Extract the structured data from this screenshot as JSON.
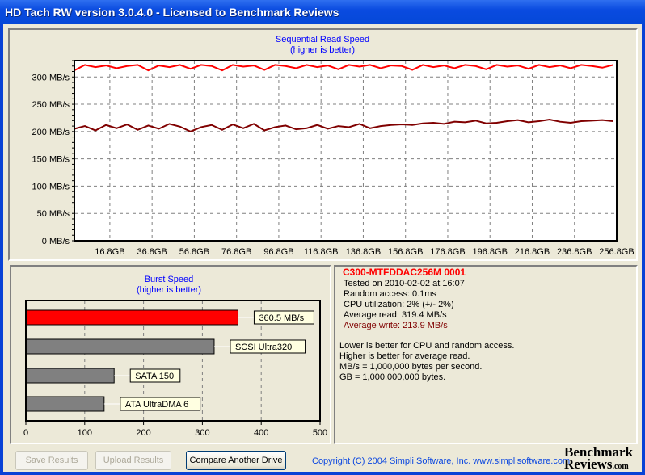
{
  "window": {
    "title": "HD Tach RW version 3.0.4.0 - Licensed to Benchmark Reviews"
  },
  "chart_data": [
    {
      "type": "line",
      "title": "Sequential Read Speed",
      "subtitle": "(higher is better)",
      "y_ticks": [
        "0 MB/s",
        "50 MB/s",
        "100 MB/s",
        "150 MB/s",
        "200 MB/s",
        "250 MB/s",
        "300 MB/s"
      ],
      "x_ticks": [
        "16.8GB",
        "36.8GB",
        "56.8GB",
        "76.8GB",
        "96.8GB",
        "116.8GB",
        "136.8GB",
        "156.8GB",
        "176.8GB",
        "196.8GB",
        "216.8GB",
        "236.8GB",
        "256.8GB"
      ],
      "xlim": [
        0,
        256.8
      ],
      "ylim": [
        0,
        330
      ],
      "grid": true,
      "x": [
        0,
        5,
        10,
        15,
        20,
        25,
        30,
        35,
        40,
        45,
        50,
        55,
        60,
        65,
        70,
        75,
        80,
        85,
        90,
        95,
        100,
        105,
        110,
        115,
        120,
        125,
        130,
        135,
        140,
        145,
        150,
        155,
        160,
        165,
        170,
        175,
        180,
        185,
        190,
        195,
        200,
        205,
        210,
        215,
        220,
        225,
        230,
        235,
        240,
        245,
        250,
        255
      ],
      "series": [
        {
          "color": "#ff0000",
          "values": [
            312,
            322,
            318,
            321,
            316,
            320,
            322,
            312,
            321,
            318,
            322,
            315,
            322,
            320,
            312,
            322,
            319,
            321,
            313,
            322,
            320,
            316,
            322,
            318,
            321,
            314,
            322,
            319,
            322,
            316,
            321,
            320,
            313,
            322,
            318,
            321,
            316,
            322,
            320,
            314,
            322,
            319,
            321,
            315,
            322,
            318,
            321,
            316,
            322,
            320,
            317,
            322
          ]
        },
        {
          "color": "#800000",
          "values": [
            205,
            210,
            202,
            212,
            206,
            213,
            203,
            211,
            205,
            214,
            209,
            200,
            208,
            212,
            203,
            213,
            206,
            214,
            202,
            208,
            211,
            204,
            206,
            212,
            205,
            210,
            208,
            214,
            206,
            210,
            212,
            213,
            212,
            215,
            216,
            214,
            218,
            217,
            220,
            215,
            216,
            219,
            221,
            217,
            219,
            222,
            218,
            216,
            219,
            220,
            221,
            219
          ]
        }
      ]
    },
    {
      "type": "bar",
      "title": "Burst Speed",
      "subtitle": "(higher is better)",
      "orientation": "horizontal",
      "xlim": [
        0,
        500
      ],
      "x_ticks": [
        "0",
        "100",
        "200",
        "300",
        "400",
        "500"
      ],
      "grid": true,
      "categories": [
        "360.5 MB/s",
        "SCSI Ultra320",
        "SATA 150",
        "ATA UltraDMA 6"
      ],
      "values": [
        360.5,
        320,
        150,
        133
      ],
      "colors": [
        "#ff0000",
        "#808080",
        "#808080",
        "#808080"
      ]
    }
  ],
  "info": {
    "drive": "C300-MTFDDAC256M 0001",
    "tested": "Tested on 2010-02-02 at 16:07",
    "random": "Random access: 0.1ms",
    "cpu": "CPU utilization: 2% (+/- 2%)",
    "read": "Average read: 319.4 MB/s",
    "write": "Average write: 213.9 MB/s",
    "notes": [
      "Lower is better for CPU and random access.",
      "Higher is better for average read.",
      "MB/s = 1,000,000 bytes per second.",
      "GB = 1,000,000,000 bytes."
    ]
  },
  "buttons": {
    "save": "Save Results",
    "upload": "Upload Results",
    "compare": "Compare Another Drive"
  },
  "footer": {
    "copyright": "Copyright (C) 2004 Simpli Software, Inc. www.simplisoftware.com",
    "logo": "Benchmark Reviews.com"
  }
}
